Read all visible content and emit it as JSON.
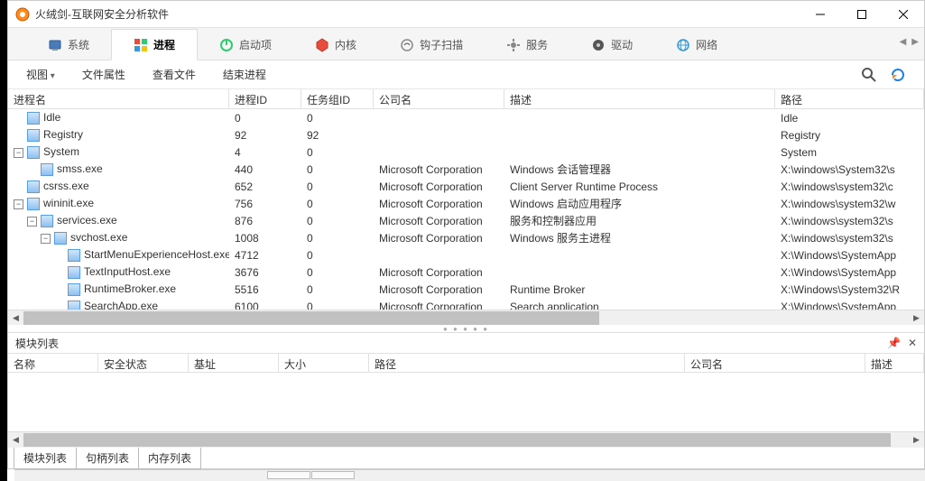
{
  "title": "火绒剑-互联网安全分析软件",
  "mainTabs": [
    {
      "label": "系统",
      "icon": "system"
    },
    {
      "label": "进程",
      "icon": "process",
      "active": true
    },
    {
      "label": "启动项",
      "icon": "startup"
    },
    {
      "label": "内核",
      "icon": "kernel"
    },
    {
      "label": "钩子扫描",
      "icon": "hook"
    },
    {
      "label": "服务",
      "icon": "service"
    },
    {
      "label": "驱动",
      "icon": "driver"
    },
    {
      "label": "网络",
      "icon": "network"
    }
  ],
  "toolbar": {
    "view": "视图",
    "fileProps": "文件属性",
    "viewFile": "查看文件",
    "endProcess": "结束进程"
  },
  "gridHeaders": {
    "name": "进程名",
    "pid": "进程ID",
    "tgid": "任务组ID",
    "company": "公司名",
    "desc": "描述",
    "path": "路径"
  },
  "processes": [
    {
      "indent": 0,
      "toggle": "",
      "name": "Idle",
      "pid": "0",
      "tgid": "0",
      "company": "",
      "desc": "",
      "path": "Idle"
    },
    {
      "indent": 0,
      "toggle": "",
      "name": "Registry",
      "pid": "92",
      "tgid": "92",
      "company": "",
      "desc": "",
      "path": "Registry"
    },
    {
      "indent": 0,
      "toggle": "-",
      "name": "System",
      "pid": "4",
      "tgid": "0",
      "company": "",
      "desc": "",
      "path": "System"
    },
    {
      "indent": 1,
      "toggle": "",
      "name": "smss.exe",
      "pid": "440",
      "tgid": "0",
      "company": "Microsoft Corporation",
      "desc": "Windows 会话管理器",
      "path": "X:\\windows\\System32\\s"
    },
    {
      "indent": 0,
      "toggle": "",
      "name": "csrss.exe",
      "pid": "652",
      "tgid": "0",
      "company": "Microsoft Corporation",
      "desc": "Client Server Runtime Process",
      "path": "X:\\windows\\system32\\c"
    },
    {
      "indent": 0,
      "toggle": "-",
      "name": "wininit.exe",
      "pid": "756",
      "tgid": "0",
      "company": "Microsoft Corporation",
      "desc": "Windows 启动应用程序",
      "path": "X:\\windows\\system32\\w"
    },
    {
      "indent": 1,
      "toggle": "-",
      "name": "services.exe",
      "pid": "876",
      "tgid": "0",
      "company": "Microsoft Corporation",
      "desc": "服务和控制器应用",
      "path": "X:\\windows\\system32\\s"
    },
    {
      "indent": 2,
      "toggle": "-",
      "name": "svchost.exe",
      "pid": "1008",
      "tgid": "0",
      "company": "Microsoft Corporation",
      "desc": "Windows 服务主进程",
      "path": "X:\\windows\\system32\\s"
    },
    {
      "indent": 3,
      "toggle": "",
      "name": "StartMenuExperienceHost.exe",
      "pid": "4712",
      "tgid": "0",
      "company": "",
      "desc": "",
      "path": "X:\\Windows\\SystemApp"
    },
    {
      "indent": 3,
      "toggle": "",
      "name": "TextInputHost.exe",
      "pid": "3676",
      "tgid": "0",
      "company": "Microsoft Corporation",
      "desc": "",
      "path": "X:\\Windows\\SystemApp"
    },
    {
      "indent": 3,
      "toggle": "",
      "name": "RuntimeBroker.exe",
      "pid": "5516",
      "tgid": "0",
      "company": "Microsoft Corporation",
      "desc": "Runtime Broker",
      "path": "X:\\Windows\\System32\\R"
    },
    {
      "indent": 3,
      "toggle": "",
      "name": "SearchApp.exe",
      "pid": "6100",
      "tgid": "0",
      "company": "Microsoft Corporation",
      "desc": "Search application",
      "path": "X:\\Windows\\SystemApp"
    }
  ],
  "modulePanel": {
    "title": "模块列表",
    "headers": {
      "name": "名称",
      "sec": "安全状态",
      "base": "基址",
      "size": "大小",
      "path": "路径",
      "company": "公司名",
      "desc": "描述"
    }
  },
  "bottomTabs": [
    {
      "label": "模块列表",
      "active": true
    },
    {
      "label": "句柄列表"
    },
    {
      "label": "内存列表"
    }
  ]
}
